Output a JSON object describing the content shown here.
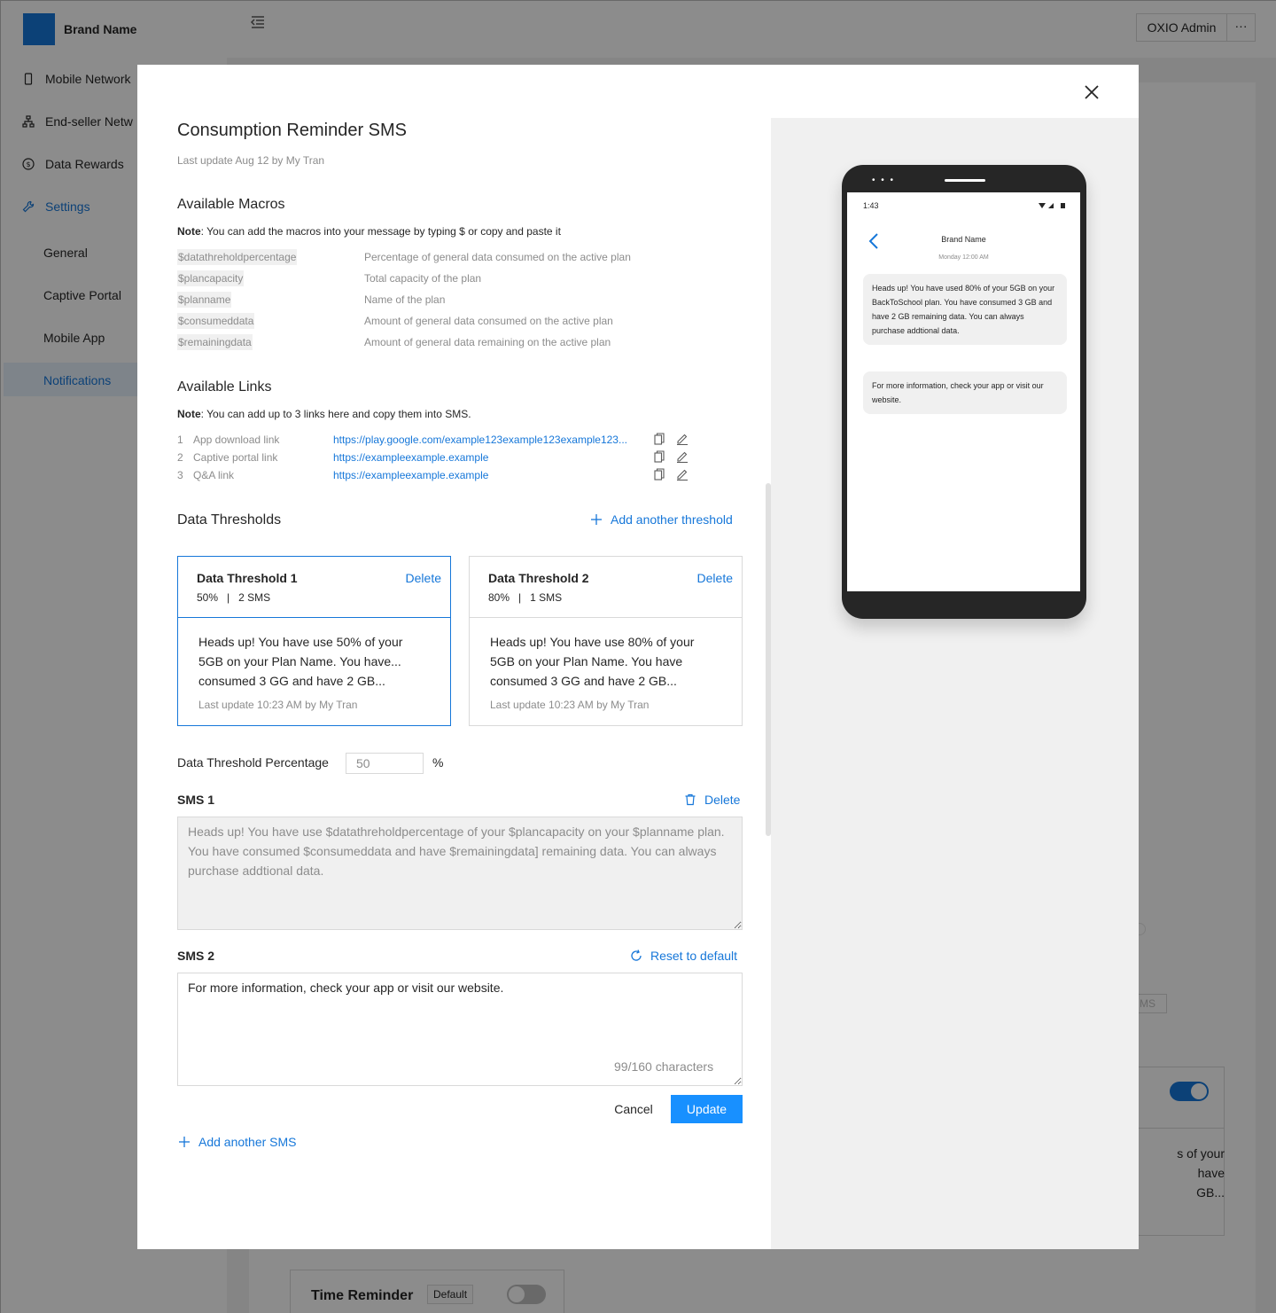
{
  "app": {
    "brand_name": "Brand Name",
    "admin_label": "OXIO Admin",
    "more_label": "···"
  },
  "sidebar": {
    "items": [
      {
        "label": "Mobile Network",
        "icon": "mobile-icon"
      },
      {
        "label": "End-seller Netw",
        "icon": "network-icon"
      },
      {
        "label": "Data Rewards",
        "icon": "dollar-icon"
      },
      {
        "label": "Settings",
        "icon": "wrench-icon"
      }
    ],
    "subitems": [
      "General",
      "Captive Portal",
      "Mobile App",
      "Notifications"
    ]
  },
  "background": {
    "card_text_lines": [
      "s of your",
      "have",
      "GB..."
    ],
    "sms_tag": "MS",
    "time_reminder_label": "Time Reminder",
    "default_tag": "Default"
  },
  "modal": {
    "title": "Consumption Reminder SMS",
    "last_update": "Last update Aug 12 by My Tran",
    "macros_title": "Available Macros",
    "macros_note_label": "Note",
    "macros_note": ": You can add the macros into your message by typing $ or copy and paste it",
    "macros": [
      {
        "name": "$datathreholdpercentage",
        "desc": "Percentage of general data consumed on the active plan"
      },
      {
        "name": "$plancapacity",
        "desc": "Total capacity of the plan"
      },
      {
        "name": "$planname",
        "desc": "Name of the plan"
      },
      {
        "name": "$consumeddata",
        "desc": "Amount of general data consumed on the active plan"
      },
      {
        "name": "$remainingdata",
        "desc": "Amount of general data remaining on the active plan"
      }
    ],
    "links_title": "Available Links",
    "links_note_label": "Note",
    "links_note": ": You can add up to 3 links here and copy them into SMS.",
    "links": [
      {
        "num": "1",
        "name": "App download link",
        "url": "https://play.google.com/example123example123example123..."
      },
      {
        "num": "2",
        "name": "Captive portal link",
        "url": "https://exampleexample.example"
      },
      {
        "num": "3",
        "name": "Q&A link",
        "url": "https://exampleexample.example"
      }
    ],
    "thresholds_title": "Data Thresholds",
    "add_threshold": "Add another threshold",
    "thresholds": [
      {
        "name": "Data Threshold 1",
        "delete": "Delete",
        "meta": "50%   |   2 SMS",
        "body": "Heads up! You have use 50% of your 5GB on your Plan Name. You have... consumed 3 GG and have 2 GB...",
        "last_update": "Last update 10:23 AM by My Tran"
      },
      {
        "name": "Data Threshold 2",
        "delete": "Delete",
        "meta": "80%   |   1 SMS",
        "body": "Heads up! You have use 80% of your 5GB on your Plan Name. You have consumed 3 GG and have 2 GB...",
        "last_update": "Last update 10:23 AM by My Tran"
      }
    ],
    "percentage_label": "Data Threshold Percentage",
    "percentage_value": "50",
    "percentage_unit": "%",
    "sms1": {
      "label": "SMS 1",
      "action": "Delete",
      "text": "Heads up! You have use $datathreholdpercentage of your $plancapacity on your $planname plan. You have consumed $consumeddata and have $remainingdata] remaining data. You can always purchase addtional data."
    },
    "sms2": {
      "label": "SMS 2",
      "action": "Reset to default",
      "text": "For more information, check your app or visit our website.",
      "char_count": "99/160 characters"
    },
    "cancel_label": "Cancel",
    "update_label": "Update",
    "add_sms": "Add another SMS"
  },
  "phone": {
    "time": "1:43",
    "brand": "Brand Name",
    "date": "Monday 12:00 AM",
    "messages": [
      "Heads up! You have used 80% of your 5GB on your BackToSchool plan. You have consumed 3 GB and have 2 GB remaining data. You can always purchase addtional data.",
      "For more information, check your app or visit our website."
    ]
  },
  "colors": {
    "accent": "#1677d9",
    "primary_button": "#1890ff",
    "overlay": "rgba(0,0,0,0.45)"
  }
}
